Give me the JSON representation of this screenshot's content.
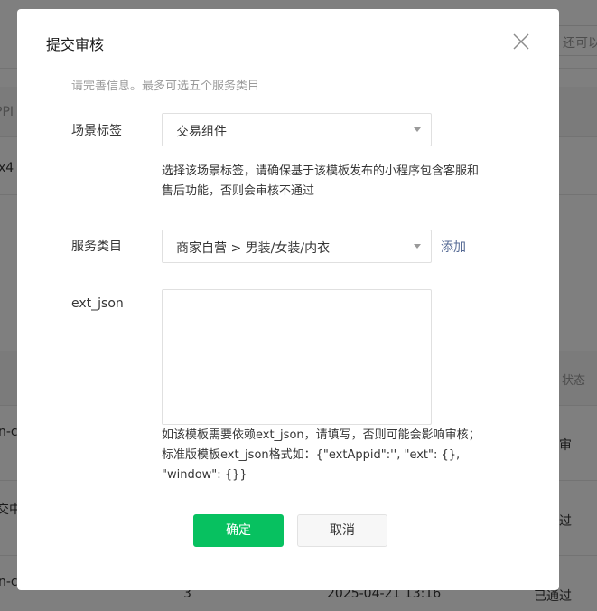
{
  "background": {
    "search_placeholder": "还可以",
    "col_header_partial": "PPI",
    "row1_partial": "x4",
    "status_header": "状态",
    "row2_left": "n-c",
    "row2_right": "审",
    "row3_left": "交中",
    "row3_right": "过",
    "row4_left": "n-c",
    "row4_mid": "3",
    "row4_date": "2025-04-21 13:16",
    "row4_right": "已通过"
  },
  "dialog": {
    "title": "提交审核",
    "hint": "请完善信息。最多可选五个服务类目",
    "scene": {
      "label": "场景标签",
      "value": "交易组件",
      "description": "选择该场景标签，请确保基于该模板发布的小程序包含客服和售后功能，否则会审核不通过"
    },
    "service": {
      "label": "服务类目",
      "value": "商家自营 > 男装/女装/内衣",
      "add_label": "添加"
    },
    "ext_json": {
      "label": "ext_json",
      "value": "",
      "description": "如该模板需要依赖ext_json，请填写，否则可能会影响审核；标准版模板ext_json格式如：{\"extAppid\":'', \"ext\": {}, \"window\": {}}"
    },
    "confirm_label": "确定",
    "cancel_label": "取消"
  },
  "colors": {
    "primary": "#07c160",
    "link": "#576b95",
    "overlay": "rgba(0,0,0,0.5)"
  },
  "icons": {
    "close": "close-icon",
    "dropdown": "chevron-down-icon"
  }
}
